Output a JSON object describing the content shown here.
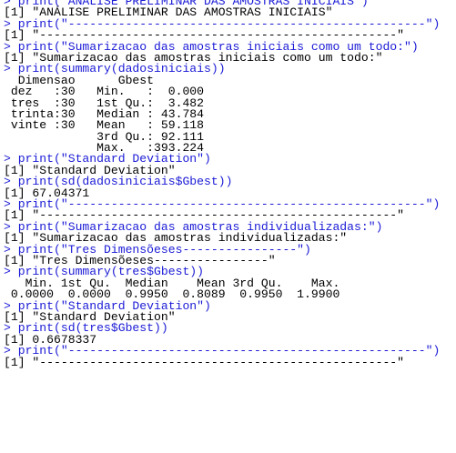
{
  "console": {
    "lines": [
      {
        "type": "input",
        "text": "> print(\"ANÁLISE PRELIMINAR DAS AMOSTRAS INICIAIS\")"
      },
      {
        "type": "output",
        "text": "[1] \"ANÁLISE PRELIMINAR DAS AMOSTRAS INICIAIS\""
      },
      {
        "type": "input",
        "text": "> print(\"--------------------------------------------------\")"
      },
      {
        "type": "output",
        "text": "[1] \"--------------------------------------------------\""
      },
      {
        "type": "input",
        "text": "> print(\"Sumarizacao das amostras iniciais como um todo:\")"
      },
      {
        "type": "output",
        "text": "[1] \"Sumarizacao das amostras iniciais como um todo:\""
      },
      {
        "type": "input",
        "text": "> print(summary(dadosiniciais))"
      },
      {
        "type": "output",
        "text": "  Dimensao      Gbest        "
      },
      {
        "type": "output",
        "text": " dez   :30   Min.   :  0.000  "
      },
      {
        "type": "output",
        "text": " tres  :30   1st Qu.:  3.482  "
      },
      {
        "type": "output",
        "text": " trinta:30   Median : 43.784  "
      },
      {
        "type": "output",
        "text": " vinte :30   Mean   : 59.118  "
      },
      {
        "type": "output",
        "text": "             3rd Qu.: 92.111  "
      },
      {
        "type": "output",
        "text": "             Max.   :393.224  "
      },
      {
        "type": "input",
        "text": "> print(\"Standard Deviation\")"
      },
      {
        "type": "output",
        "text": "[1] \"Standard Deviation\""
      },
      {
        "type": "input",
        "text": "> print(sd(dadosiniciais$Gbest))"
      },
      {
        "type": "output",
        "text": "[1] 67.04371"
      },
      {
        "type": "input",
        "text": "> print(\"--------------------------------------------------\")"
      },
      {
        "type": "output",
        "text": "[1] \"--------------------------------------------------\""
      },
      {
        "type": "input",
        "text": "> print(\"Sumarizacao das amostras individualizadas:\")"
      },
      {
        "type": "output",
        "text": "[1] \"Sumarizacao das amostras individualizadas:\""
      },
      {
        "type": "input",
        "text": "> print(\"Tres Dimensõeses----------------\")"
      },
      {
        "type": "output",
        "text": "[1] \"Tres Dimensõeses----------------\""
      },
      {
        "type": "input",
        "text": "> print(summary(tres$Gbest))"
      },
      {
        "type": "output",
        "text": "   Min. 1st Qu.  Median    Mean 3rd Qu.    Max. "
      },
      {
        "type": "output",
        "text": " 0.0000  0.0000  0.9950  0.8089  0.9950  1.9900 "
      },
      {
        "type": "input",
        "text": "> print(\"Standard Deviation\")"
      },
      {
        "type": "output",
        "text": "[1] \"Standard Deviation\""
      },
      {
        "type": "input",
        "text": "> print(sd(tres$Gbest))"
      },
      {
        "type": "output",
        "text": "[1] 0.6678337"
      },
      {
        "type": "input",
        "text": "> print(\"--------------------------------------------------\")"
      },
      {
        "type": "output",
        "text": "[1] \"--------------------------------------------------\""
      }
    ]
  },
  "colors": {
    "input": "#1a1ad6",
    "output": "#000000",
    "background": "#ffffff"
  }
}
